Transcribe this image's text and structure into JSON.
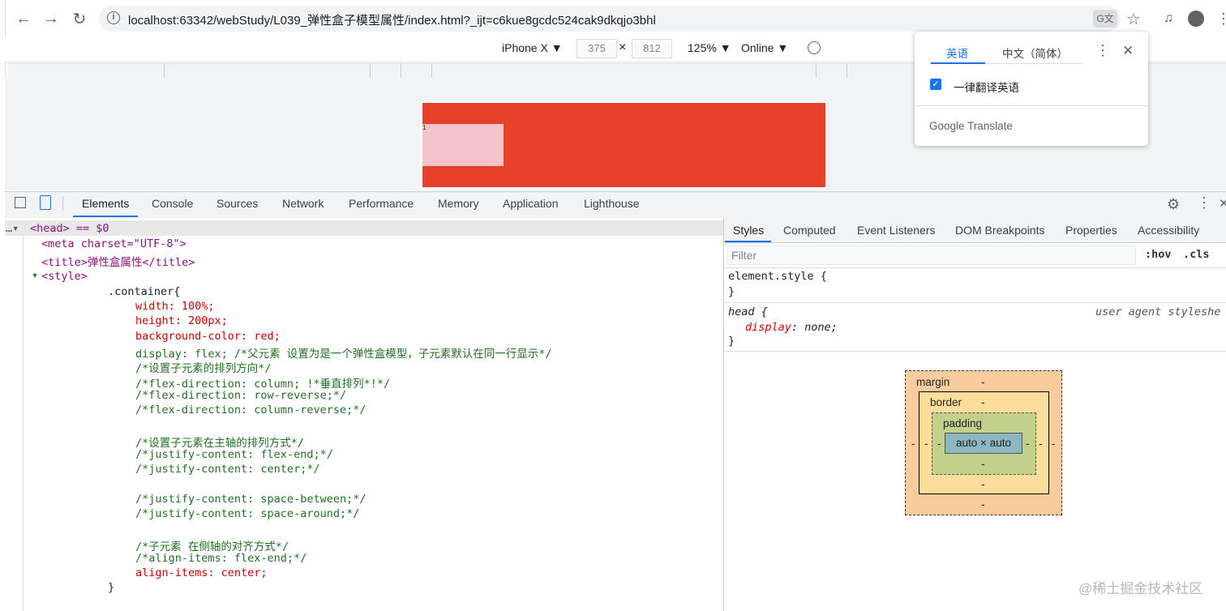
{
  "browser": {
    "url": "localhost:63342/webStudy/L039_弹性盒子模型属性/index.html?_ijt=c6kue8gcdc524cak9dkqjo3bhl",
    "icons": [
      "back-icon",
      "forward-icon",
      "reload-icon",
      "info-icon",
      "translate-icon",
      "star-icon",
      "media-icon",
      "profile-icon",
      "menu-icon"
    ]
  },
  "device_toolbar": {
    "device": "iPhone X ▼",
    "width": "375",
    "times": "×",
    "height": "812",
    "zoom": "125% ▼",
    "network": "Online ▼"
  },
  "page": {
    "child_text": "1"
  },
  "translate_popup": {
    "tab_en": "英语",
    "tab_zh": "中文（简体）",
    "always_label": "一律翻译英语",
    "brand_google": "Google",
    "brand_translate": "Translate",
    "accent": "#1a73e8"
  },
  "devtools": {
    "tabs": [
      "Elements",
      "Console",
      "Sources",
      "Network",
      "Performance",
      "Memory",
      "Application",
      "Lighthouse"
    ],
    "active_tab": "Elements"
  },
  "dom": {
    "head_line": "<head> == $0",
    "meta_line": "<meta charset=\"UTF-8\">",
    "title_line": "<title>弹性盒属性</title>",
    "style_line": "<style>",
    "css_lines": [
      ".container{",
      "width: 100%;",
      "height: 200px;",
      "background-color: red;",
      "display: flex; /*父元素 设置为是一个弹性盒模型，子元素默认在同一行显示*/",
      "/*设置子元素的排列方向*/",
      "/*flex-direction: column; !*垂直排列*!*/",
      "/*flex-direction: row-reverse;*/",
      "/*flex-direction: column-reverse;*/",
      "",
      "/*设置子元素在主轴的排列方式*/",
      "/*justify-content: flex-end;*/",
      "/*justify-content: center;*/",
      "",
      "/*justify-content: space-between;*/",
      "/*justify-content: space-around;*/",
      "",
      "/*子元素 在侧轴的对齐方式*/",
      "/*align-items: flex-end;*/",
      "align-items: center;",
      "}"
    ]
  },
  "styles": {
    "tabs": [
      "Styles",
      "Computed",
      "Event Listeners",
      "DOM Breakpoints",
      "Properties",
      "Accessibility"
    ],
    "filter_placeholder": "Filter",
    "hov": ":hov",
    "cls": ".cls",
    "element_style": "element.style {",
    "close_brace": "}",
    "head_selector": "head",
    "open_brace": " {",
    "head_prop": "display",
    "head_val": "none",
    "ua_source": "user agent styleshe"
  },
  "box_model": {
    "margin_label": "margin",
    "border_label": "border",
    "padding_label": "padding",
    "content": "auto × auto",
    "dash": "-"
  },
  "watermark": "@稀土掘金技术社区"
}
